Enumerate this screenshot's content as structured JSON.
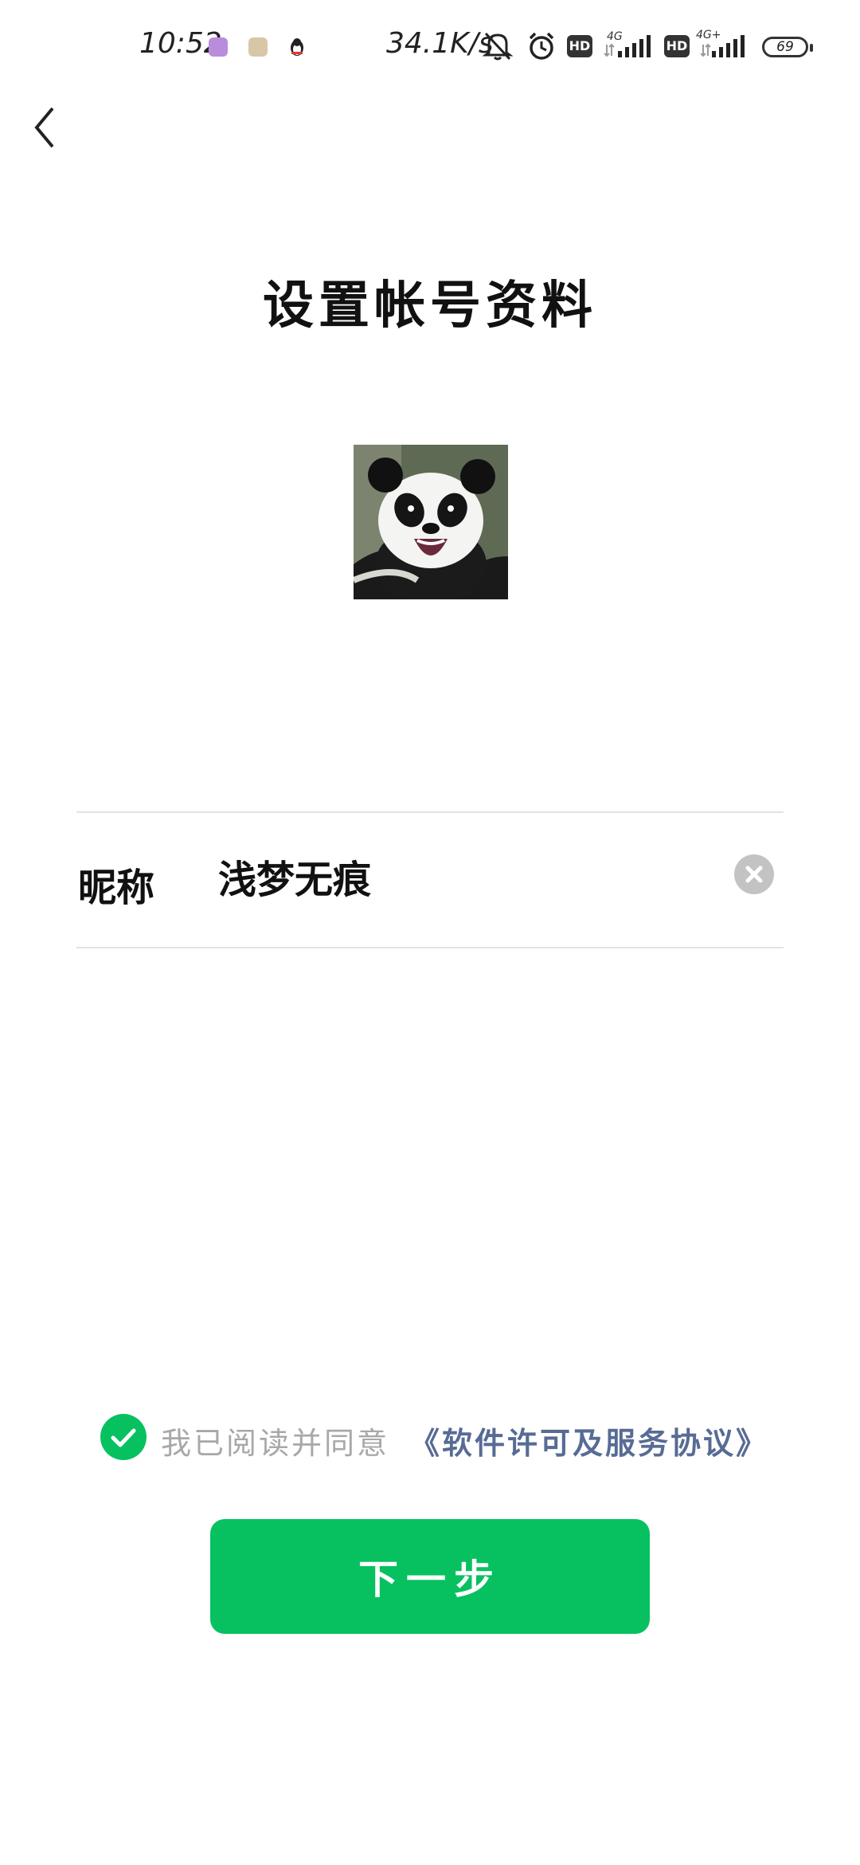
{
  "status_bar": {
    "time": "10:52",
    "net_speed": "34.1K/s",
    "hd_label": "HD",
    "network_1": "4G",
    "network_2": "4G+",
    "battery": "69"
  },
  "page": {
    "title": "设置帐号资料"
  },
  "avatar": {
    "icon": "panda-avatar"
  },
  "nickname": {
    "label": "昵称",
    "value": "浅梦无痕"
  },
  "agreement": {
    "checked": true,
    "text": "我已阅读并同意",
    "link": "《软件许可及服务协议》"
  },
  "actions": {
    "next_label": "下一步"
  },
  "colors": {
    "primary": "#07c160",
    "link": "#576b95",
    "muted_text": "#a8a8a8"
  }
}
